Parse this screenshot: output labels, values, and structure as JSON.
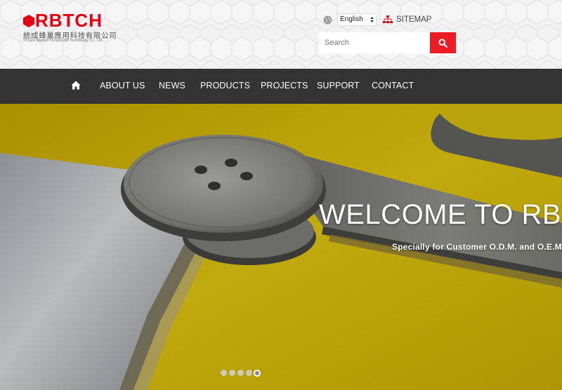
{
  "header": {
    "logo": {
      "wordmark": "RBTCH",
      "chinese_name": "統成蜂巢應用科技有限公司",
      "english_name": "TCoere Applied Honeycomb Technology Co., Ltd."
    },
    "language": {
      "selected": "English",
      "icon": "globe-icon"
    },
    "sitemap": {
      "label": "SITEMAP",
      "icon": "sitemap-icon"
    },
    "search": {
      "placeholder": "Search",
      "icon": "search-icon"
    },
    "colors": {
      "brand": "#e60012",
      "search_button": "#ed1c24",
      "nav_bg": "#333333"
    }
  },
  "nav": {
    "home_icon": "home-icon",
    "items": [
      {
        "label": "ABOUT US"
      },
      {
        "label": "NEWS"
      },
      {
        "label": "PRODUCTS"
      },
      {
        "label": "PROJECTS"
      },
      {
        "label": "SUPPORT"
      },
      {
        "label": "CONTACT"
      }
    ]
  },
  "hero": {
    "title": "WELCOME TO RBTCH",
    "subtitle": "Specially for Customer O.D.M. and O.E.M. Service",
    "slide_count": 5,
    "active_slide": 5
  }
}
